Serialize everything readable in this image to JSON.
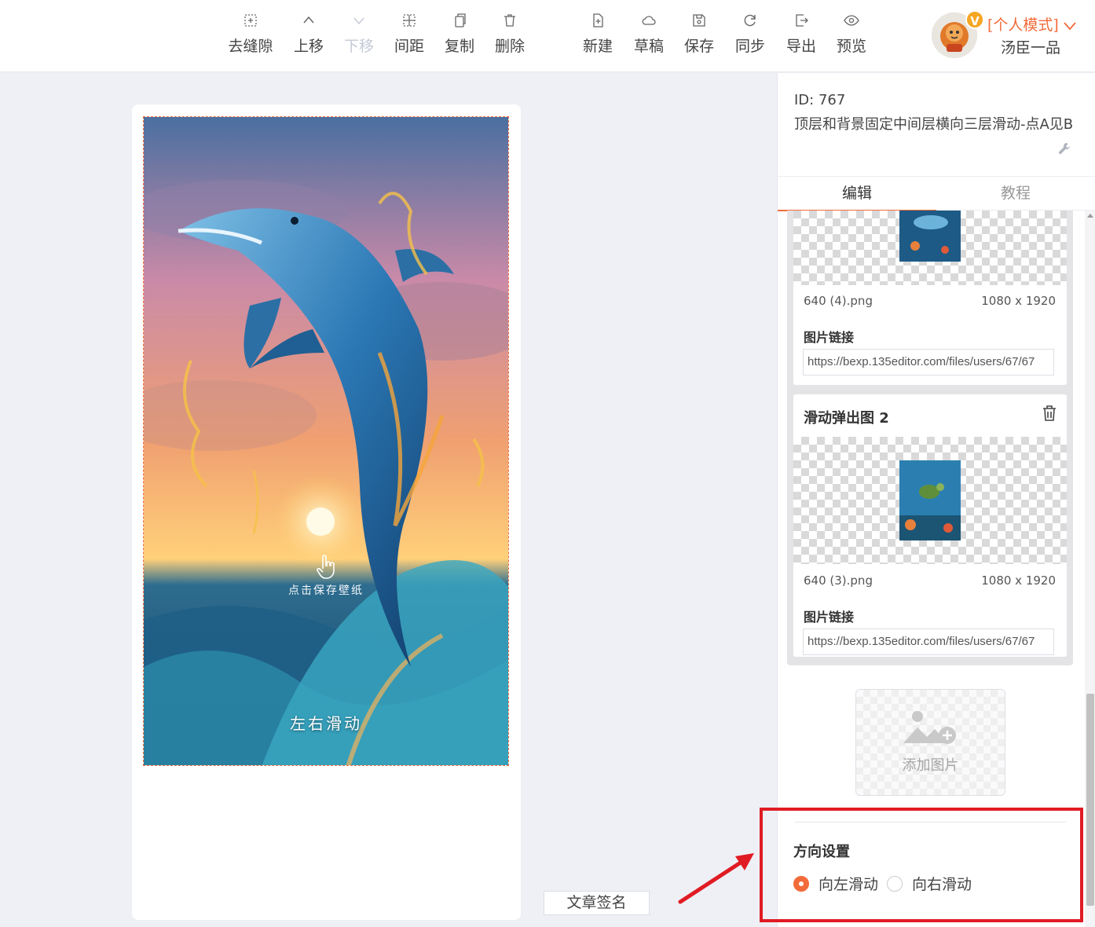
{
  "toolbar": {
    "items": [
      {
        "label": "去缝隙",
        "icon": "gap-remove-icon"
      },
      {
        "label": "上移",
        "icon": "chevron-up-icon"
      },
      {
        "label": "下移",
        "icon": "chevron-down-icon",
        "disabled": true
      },
      {
        "label": "间距",
        "icon": "spacing-icon"
      },
      {
        "label": "复制",
        "icon": "copy-icon"
      },
      {
        "label": "删除",
        "icon": "trash-icon"
      },
      {
        "label": "新建",
        "icon": "new-file-icon"
      },
      {
        "label": "草稿",
        "icon": "cloud-icon"
      },
      {
        "label": "保存",
        "icon": "save-icon"
      },
      {
        "label": "同步",
        "icon": "sync-icon"
      },
      {
        "label": "导出",
        "icon": "export-icon"
      },
      {
        "label": "预览",
        "icon": "eye-icon"
      }
    ]
  },
  "user": {
    "badge": "V",
    "mode": "[个人模式]",
    "name": "汤臣一品"
  },
  "canvas": {
    "tap_hint": "点击保存壁纸",
    "slide_hint": "左右滑动",
    "signature_button": "文章签名"
  },
  "panel": {
    "id_text": "ID: 767",
    "title": "顶层和背景固定中间层横向三层滑动-点A见B",
    "tabs": [
      {
        "label": "编辑",
        "active": true
      },
      {
        "label": "教程",
        "active": false
      }
    ],
    "images": [
      {
        "file_name": "640 (4).png",
        "dimensions": "1080 x 1920",
        "link_label": "图片链接",
        "link_value": "https://bexp.135editor.com/files/users/67/67"
      },
      {
        "title": "滑动弹出图 2",
        "file_name": "640 (3).png",
        "dimensions": "1080 x 1920",
        "link_label": "图片链接",
        "link_value": "https://bexp.135editor.com/files/users/67/67"
      }
    ],
    "add_image_label": "添加图片",
    "direction": {
      "title": "方向设置",
      "options": [
        {
          "label": "向左滑动",
          "checked": true
        },
        {
          "label": "向右滑动",
          "checked": false
        }
      ]
    }
  },
  "colors": {
    "accent": "#f26b3a",
    "annotation": "#e01b24"
  }
}
